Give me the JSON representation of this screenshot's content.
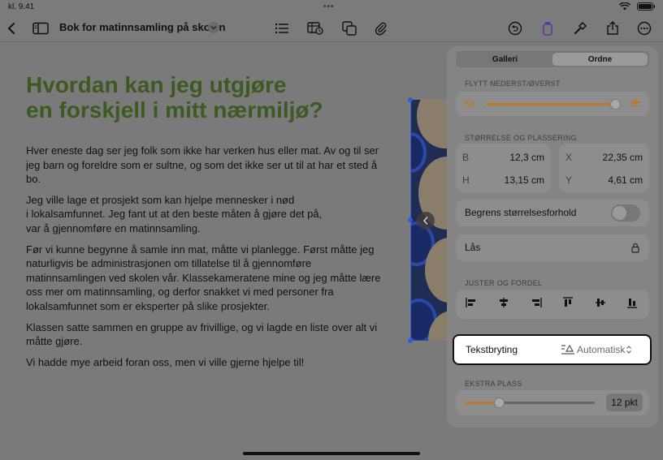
{
  "status": {
    "time": "kl. 9.41"
  },
  "toolbar": {
    "title": "Bok for matinnsamling på skolen"
  },
  "doc": {
    "heading_line1": "Hvordan kan jeg utgjøre",
    "heading_line2": "en forskjell i mitt nærmiljø?",
    "p1": "Hver eneste dag ser jeg folk som ikke har verken hus eller mat. Av og til ser jeg barn og foreldre som er sultne, og som det ikke ser ut til at har et sted å bo.",
    "p2_l1": "Jeg ville lage et prosjekt som kan hjelpe mennesker i nød",
    "p2_l2": "i lokalsamfunnet. Jeg fant ut at den beste måten å gjøre det på,",
    "p2_l3": "var å gjennomføre en matinnsamling.",
    "p3": "Før vi kunne begynne å samle inn mat, måtte vi planlegge. Først måtte jeg naturligvis be administrasjonen om tillatelse til å gjennomføre matinnsamlingen ved skolen vår. Klassekameratene mine og jeg måtte lære oss mer om matinnsamling, og derfor snakket vi med personer fra lokalsamfunnet som er eksperter på slike prosjekter.",
    "p4": "Klassen satte sammen en gruppe av frivillige, og vi lagde en liste over alt vi måtte gjøre.",
    "p5": "Vi hadde mye arbeid foran oss, men vi ville gjerne hjelpe til!"
  },
  "panel": {
    "tabs": [
      "Galleri",
      "Ordne"
    ],
    "active_tab": "Ordne",
    "move_label": "FLYTT NEDERST/ØVERST",
    "move_slider_value": 1.0,
    "size_label": "STØRRELSE OG PLASSERING",
    "b_label": "B",
    "b_value": "12,3 cm",
    "x_label": "X",
    "x_value": "22,35 cm",
    "h_label": "H",
    "h_value": "13,15 cm",
    "y_label": "Y",
    "y_value": "4,61 cm",
    "constrain_label": "Begrens størrelsesforhold",
    "constrain_on": false,
    "lock_label": "Lås",
    "align_label": "JUSTER OG FORDEL",
    "wrap_label": "Tekstbryting",
    "wrap_value": "Automatisk",
    "extra_label": "EKSTRA PLASS",
    "extra_value": "12 pkt",
    "extra_slider_value": 0.27
  },
  "colors": {
    "accent": "#b77b22",
    "heading": "#3e5a22",
    "selection": "#2d5bd8"
  }
}
